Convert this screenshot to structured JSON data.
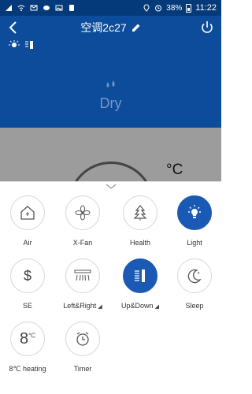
{
  "status": {
    "battery_pct": "38%",
    "time": "11:22"
  },
  "header": {
    "title": "空调2c27"
  },
  "mode": {
    "label": "Dry"
  },
  "temperature": {
    "unit": "°C"
  },
  "functions": [
    {
      "label": "Air",
      "active": false,
      "icon": "house-fan-icon"
    },
    {
      "label": "X-Fan",
      "active": false,
      "icon": "fan-icon"
    },
    {
      "label": "Health",
      "active": false,
      "icon": "tree-icon"
    },
    {
      "label": "Light",
      "active": true,
      "icon": "bulb-icon"
    },
    {
      "label": "SE",
      "active": false,
      "icon": "dollar-icon"
    },
    {
      "label": "Left&Right",
      "active": false,
      "icon": "horizontal-swing-icon",
      "has_dropdown": true
    },
    {
      "label": "Up&Down",
      "active": true,
      "icon": "vertical-swing-icon",
      "has_dropdown": true
    },
    {
      "label": "Sleep",
      "active": false,
      "icon": "moon-icon"
    },
    {
      "label": "8℃ heating",
      "active": false,
      "icon": "eight-degree-icon"
    },
    {
      "label": "Timer",
      "active": false,
      "icon": "alarm-clock-icon"
    }
  ],
  "colors": {
    "header_blue": "#0d4c9a",
    "active_blue": "#1a5ab4",
    "status_blue": "#053a7a"
  }
}
